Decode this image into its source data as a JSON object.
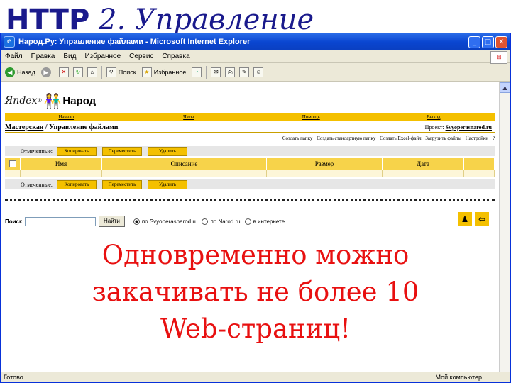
{
  "slide": {
    "title_bold": "HTTP",
    "title_rest": " 2. Управление",
    "overlay_lines": [
      "Одновременно можно",
      "закачивать не более 10",
      "Web-страниц!"
    ]
  },
  "window": {
    "title": "Народ.Ру: Управление файлами - Microsoft Internet Explorer",
    "menus": [
      "Файл",
      "Правка",
      "Вид",
      "Избранное",
      "Сервис",
      "Справка"
    ],
    "toolbar": {
      "back": "Назад",
      "search": "Поиск",
      "favorites": "Избранное"
    },
    "status": {
      "left": "Готово",
      "zone": "Мой компьютер"
    }
  },
  "page": {
    "logo_yandex": "Яndex",
    "logo_narod": "Народ",
    "nav": [
      "Начало",
      "Чаты",
      "Помощь",
      "Выход"
    ],
    "breadcrumb_root": "Мастерская",
    "breadcrumb_current": " / Управление файлами",
    "site_label": "Проект:",
    "site_value": "Svyoperasnarod.ru",
    "links": "Создать папку · Создать стандартную папку · Создать Excel-файл · Загрузить файлы · Настройки · ?",
    "actions_label": "Отмеченные:",
    "actions": [
      "Копировать",
      "Переместить",
      "Удалить"
    ],
    "columns": [
      "Имя",
      "Описание",
      "Размер",
      "Дата"
    ],
    "search": {
      "label": "Поиск",
      "button": "Найти",
      "options": [
        "по Svyoperasnarod.ru",
        "по Narod.ru",
        "в интернете"
      ]
    }
  }
}
